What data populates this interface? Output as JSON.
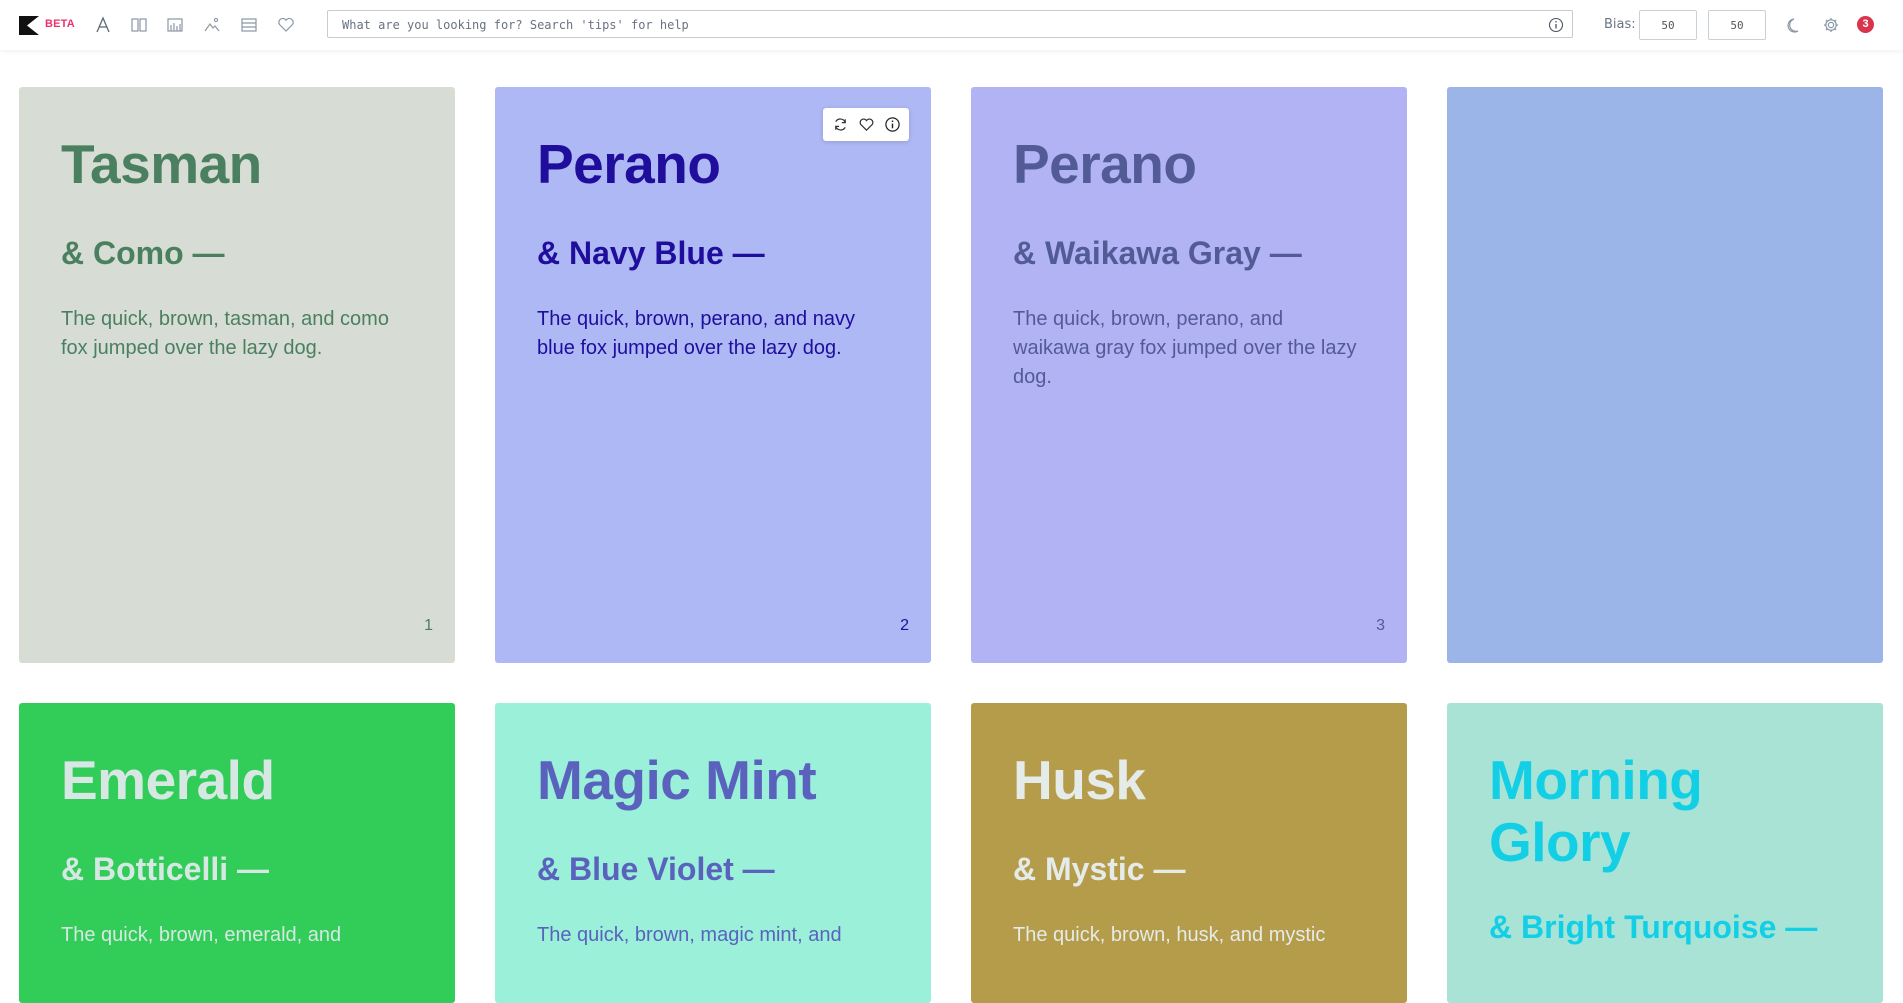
{
  "header": {
    "logo_text": "BETA",
    "search": {
      "placeholder": "What are you looking for? Search 'tips' for help",
      "value": ""
    },
    "bias": {
      "label": "Bias:",
      "value1": "50",
      "value2": "50"
    },
    "notifications_count": "3",
    "icons": [
      "font-icon",
      "columns-icon",
      "chart-icon",
      "image-icon",
      "rows-icon",
      "heart-icon",
      "info-icon",
      "moon-icon",
      "gear-icon"
    ]
  },
  "cards": [
    {
      "title": "Tasman",
      "subtitle": "& Como —",
      "body": "The quick, brown, tasman, and como fox jumped over the lazy dog.",
      "number": "1",
      "bg": "#d7ddd5",
      "fg": "#4a8060"
    },
    {
      "title": "Perano",
      "subtitle": "& Navy Blue —",
      "body": "The quick, brown, perano, and navy blue fox jumped over the lazy dog.",
      "number": "2",
      "bg": "#adb8f4",
      "fg": "#1f0d9c"
    },
    {
      "title": "Perano",
      "subtitle": "& Waikawa Gray —",
      "body": "The quick, brown, perano, and waikawa gray fox jumped over the lazy dog.",
      "number": "3",
      "bg": "#b2b3f4",
      "fg": "#535b96"
    },
    {
      "title": "",
      "subtitle": "",
      "body": "",
      "number": "",
      "bg": "#9bb5e8",
      "fg": "#ffffff"
    },
    {
      "title": "Emerald",
      "subtitle": "& Botticelli —",
      "body": "The quick, brown, emerald, and",
      "number": "",
      "bg": "#32cc58",
      "fg": "#d7e8e4"
    },
    {
      "title": "Magic Mint",
      "subtitle": "& Blue Violet —",
      "body": "The quick, brown, magic mint, and",
      "number": "",
      "bg": "#9af0d8",
      "fg": "#5a62be"
    },
    {
      "title": "Husk",
      "subtitle": "& Mystic —",
      "body": "The quick, brown, husk, and mystic",
      "number": "",
      "bg": "#b59c4a",
      "fg": "#e4ebe9"
    },
    {
      "title": "Morning Glory",
      "subtitle": "& Bright Turquoise —",
      "body": "",
      "number": "",
      "bg": "#a8e3d6",
      "fg": "#13cfe6"
    }
  ]
}
